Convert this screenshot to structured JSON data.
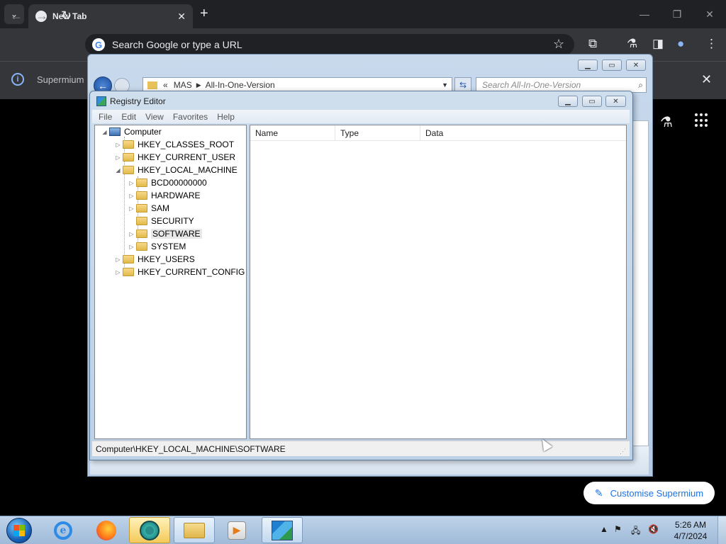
{
  "browser": {
    "tab_title": "New Tab",
    "omnibox_placeholder": "Search Google or type a URL",
    "infobar_text": "Supermium",
    "customise_label": "Customise Supermium"
  },
  "explorer": {
    "address_prefix": "«",
    "address_parts": [
      "MAS",
      "All-In-One-Version"
    ],
    "search_placeholder": "Search All-In-One-Version"
  },
  "regedit": {
    "title": "Registry Editor",
    "menu": [
      "File",
      "Edit",
      "View",
      "Favorites",
      "Help"
    ],
    "columns": [
      "Name",
      "Type",
      "Data"
    ],
    "status_path": "Computer\\HKEY_LOCAL_MACHINE\\SOFTWARE",
    "tree": {
      "root": "Computer",
      "hkcr": "HKEY_CLASSES_ROOT",
      "hkcu": "HKEY_CURRENT_USER",
      "hklm": "HKEY_LOCAL_MACHINE",
      "bcd": "BCD00000000",
      "hardware": "HARDWARE",
      "sam": "SAM",
      "security": "SECURITY",
      "software": "SOFTWARE",
      "system": "SYSTEM",
      "hku": "HKEY_USERS",
      "hkcc": "HKEY_CURRENT_CONFIG"
    },
    "selected_key": "SOFTWARE"
  },
  "taskbar": {
    "time": "5:26 AM",
    "date": "4/7/2024",
    "pinned_icons": [
      "start-orb",
      "internet-explorer-icon",
      "firefox-icon",
      "chrome-icon",
      "file-explorer-icon",
      "media-player-icon",
      "registry-editor-icon"
    ]
  }
}
